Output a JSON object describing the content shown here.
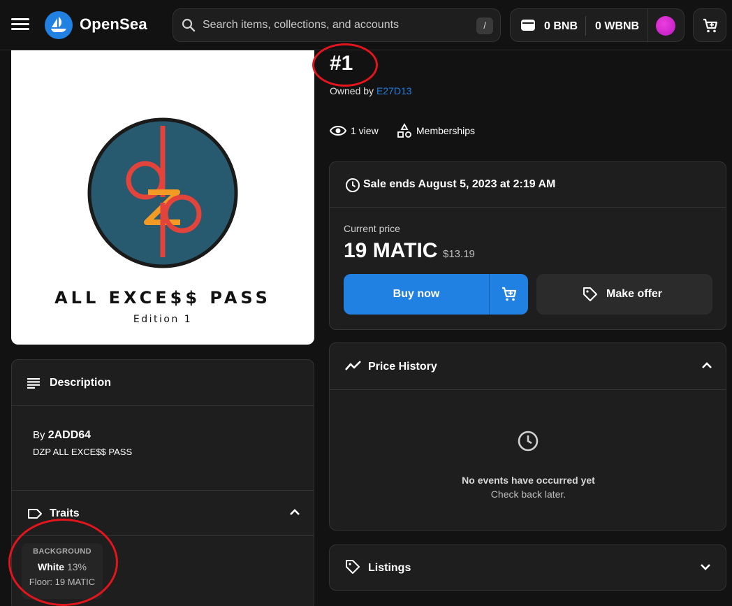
{
  "header": {
    "brand": "OpenSea",
    "search_placeholder": "Search items, collections, and accounts",
    "search_shortcut": "/",
    "balance_bnb": "0 BNB",
    "balance_wbnb": "0 WBNB"
  },
  "artwork": {
    "title": "ALL EXCE$$ PASS",
    "edition": "Edition 1",
    "logo_letters": "dzp",
    "colors": {
      "circle": "#275a6e",
      "red_letters": "#e2433a",
      "orange_z": "#f39a25"
    }
  },
  "item": {
    "title": "#1",
    "owned_label": "Owned by",
    "owner": "E27D13",
    "views": "1 view",
    "category": "Memberships"
  },
  "sale": {
    "ends": "Sale ends August 5, 2023 at 2:19 AM",
    "price_label": "Current price",
    "price": "19 MATIC",
    "price_usd": "$13.19",
    "buy_label": "Buy now",
    "offer_label": "Make offer"
  },
  "description": {
    "heading": "Description",
    "by_prefix": "By",
    "creator": "2ADD64",
    "text": "DZP ALL EXCE$$ PASS"
  },
  "traits": {
    "heading": "Traits",
    "items": [
      {
        "type": "BACKGROUND",
        "value": "White",
        "percent": "13%",
        "floor": "Floor: 19 MATIC"
      }
    ]
  },
  "price_history": {
    "heading": "Price History",
    "empty_title": "No events have occurred yet",
    "empty_sub": "Check back later."
  },
  "listings": {
    "heading": "Listings"
  },
  "theme": {
    "accent": "#2081e2",
    "background": "#121212",
    "panel": "#1e1e1e",
    "annotation": "#e3151c"
  }
}
